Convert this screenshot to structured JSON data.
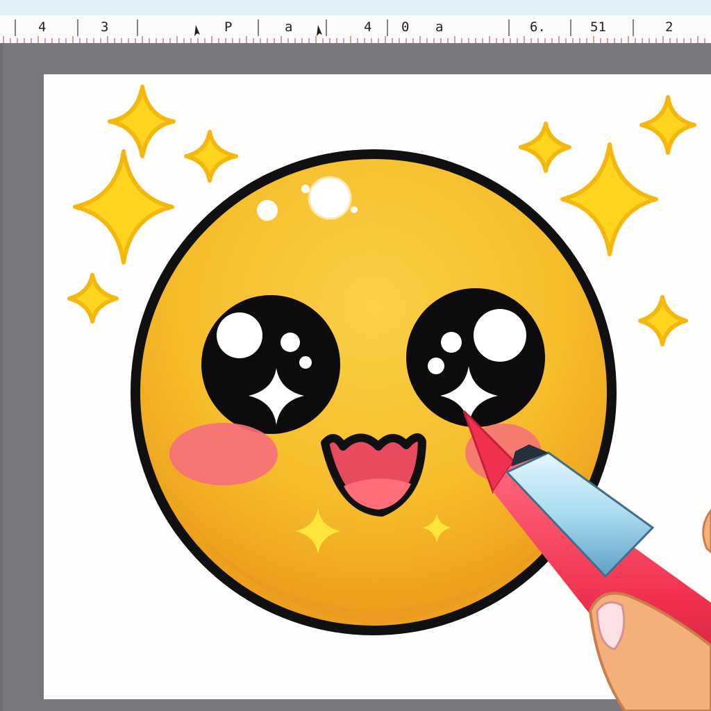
{
  "window": {
    "title": ""
  },
  "ruler": {
    "labels": [
      "4",
      "3",
      "P",
      "a",
      "4",
      "0",
      "a",
      "6.",
      "51",
      "2"
    ]
  },
  "canvas": {
    "subject": "smiley-face-emoji",
    "colors": {
      "face": "#f6bd2b",
      "face_shade": "#eda11f",
      "outline": "#101010",
      "eye": "#0d0b0e",
      "cheek": "#f4707a",
      "mouth": "#e94b5e",
      "sparkle": "#ffd41f",
      "sparkle_edge": "#f3b80f",
      "crayon_body": "#f0314f",
      "crayon_band": "#a8dbf0",
      "hand": "#f4b07a"
    }
  }
}
